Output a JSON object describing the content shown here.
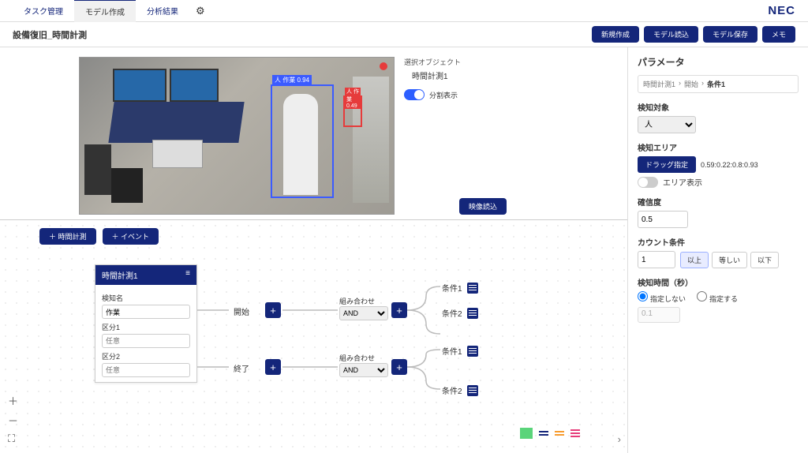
{
  "header": {
    "tabs": [
      "タスク管理",
      "モデル作成",
      "分析結果"
    ],
    "active_tab": 1,
    "logo": "NEC"
  },
  "subheader": {
    "title": "設備復旧_時間計測",
    "buttons": [
      "新規作成",
      "モデル読込",
      "モデル保存",
      "メモ"
    ]
  },
  "video_panel": {
    "selected_object_label": "選択オブジェクト",
    "selected_object_value": "時間計測1",
    "split_display_label": "分割表示",
    "load_button": "映像読込",
    "bbox1_label": "人 作業 0.94",
    "bbox2_label": "人 作業 0.49"
  },
  "canvas": {
    "toolbar": [
      "＋ 時間計測",
      "＋ イベント"
    ],
    "node": {
      "title": "時間計測1",
      "menu_icon": "≡",
      "fields": {
        "detect_name_label": "検知名",
        "detect_name_value": "作業",
        "seg1_label": "区分1",
        "seg1_placeholder": "任意",
        "seg2_label": "区分2",
        "seg2_placeholder": "任意"
      }
    },
    "start_label": "開始",
    "end_label": "終了",
    "combine_label": "組み合わせ",
    "combine_value": "AND",
    "conditions": [
      "条件1",
      "条件2",
      "条件1",
      "条件2"
    ]
  },
  "right_panel": {
    "title": "パラメータ",
    "breadcrumb": [
      "時間計測1",
      "開始",
      "条件1"
    ],
    "detect_target_label": "検知対象",
    "detect_target_value": "人",
    "detect_area_label": "検知エリア",
    "drag_button": "ドラッグ指定",
    "coords": "0.59:0.22:0.8:0.93",
    "area_display_label": "エリア表示",
    "confidence_label": "確信度",
    "confidence_value": "0.5",
    "count_cond_label": "カウント条件",
    "count_value": "1",
    "count_options": [
      "以上",
      "等しい",
      "以下"
    ],
    "count_active": 0,
    "detect_time_label": "検知時間（秒）",
    "detect_time_options": [
      "指定しない",
      "指定する"
    ],
    "detect_time_selected": 0,
    "detect_time_value": "0.1"
  }
}
